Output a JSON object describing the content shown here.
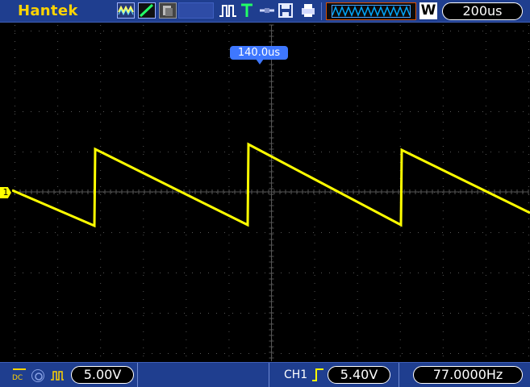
{
  "header": {
    "brand": "Hantek",
    "timebase": "200us",
    "mode_label": "W"
  },
  "screen": {
    "trigger_position": "140.0us",
    "channel_marker": "1",
    "trace_color": "#ffff00",
    "grid_color": "#555555"
  },
  "footer": {
    "coupling": "DC",
    "ch1_scale": "5.00V",
    "trigger_source": "CH1",
    "trigger_level": "5.40V",
    "frequency": "77.0000Hz"
  },
  "icons": [
    "waveform-icon",
    "slope-icon",
    "display-icon",
    "pulse-icon",
    "trigger-icon",
    "link-icon",
    "save-icon",
    "print-icon",
    "memory-depth-icon",
    "coupling-icon",
    "bandwidth-icon",
    "rising-edge-icon"
  ]
}
